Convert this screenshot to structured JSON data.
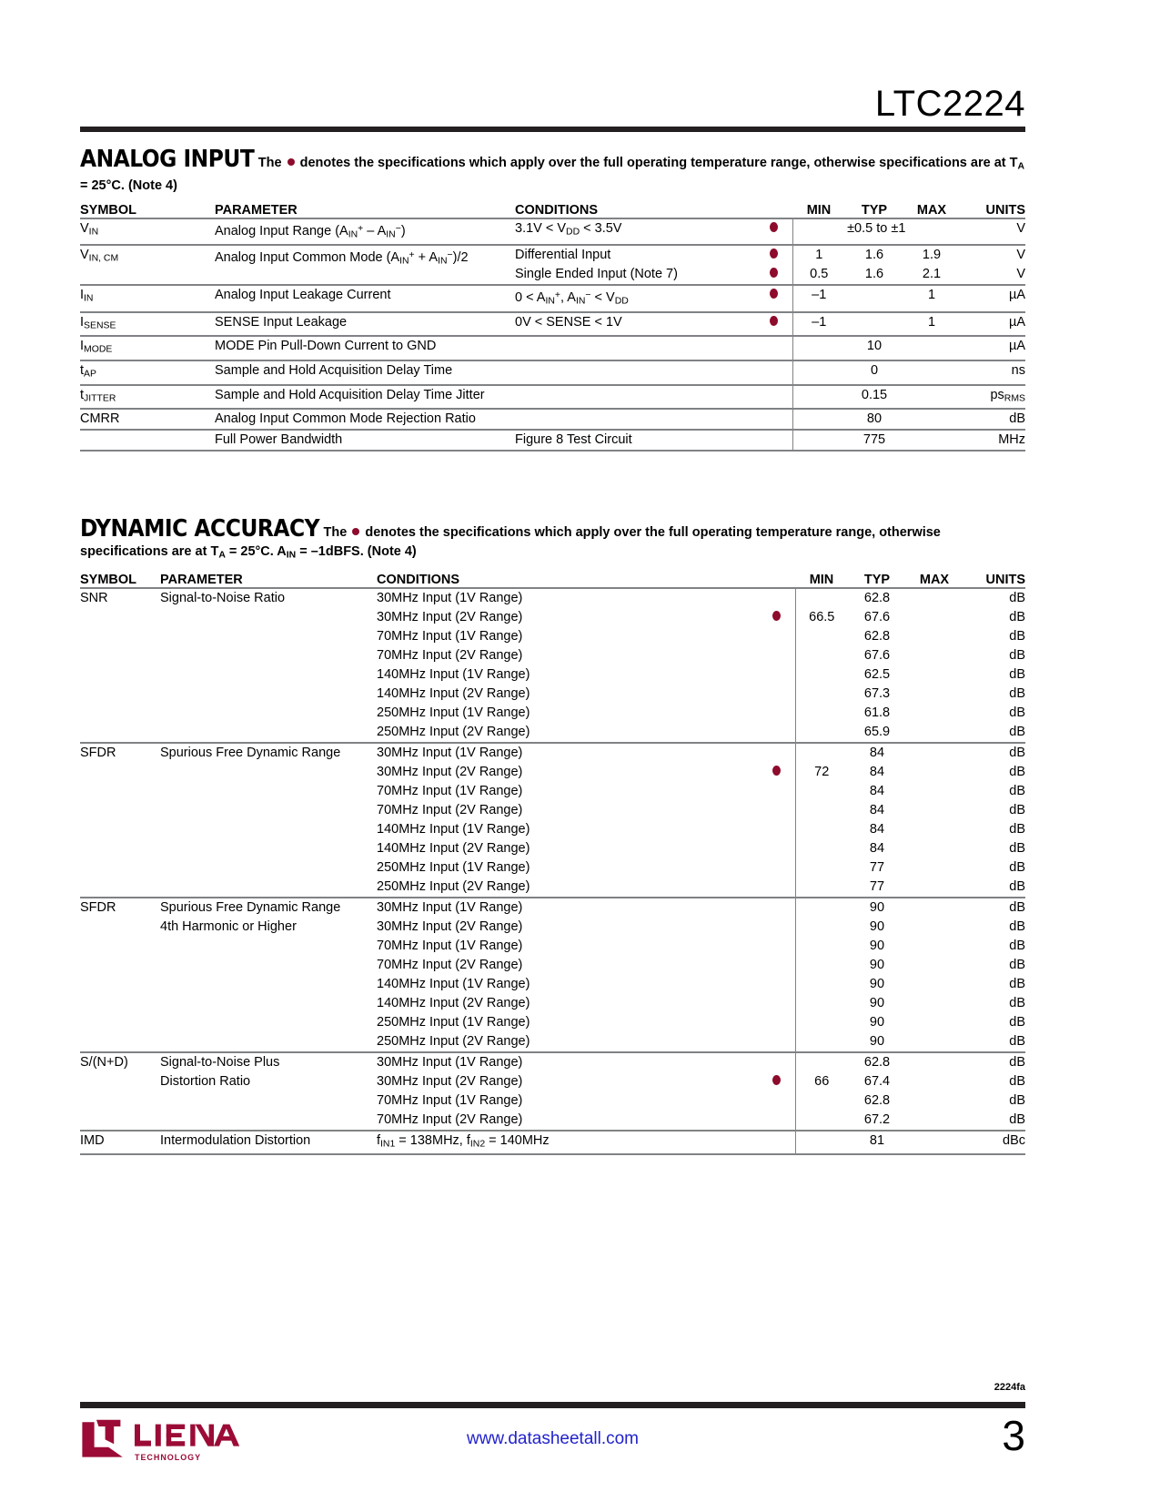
{
  "header": {
    "part_number": "LTC2224"
  },
  "sections": [
    {
      "title": "ANALOG INPUT",
      "note_pre": "The",
      "note_post": "denotes the specifications which apply over the full operating temperature range, otherwise specifications are at T",
      "note_sub": "A",
      "note_tail": " = 25°C. (Note 4)",
      "columns": [
        "SYMBOL",
        "PARAMETER",
        "CONDITIONS",
        "MIN",
        "TYP",
        "MAX",
        "UNITS"
      ],
      "rows": [
        {
          "symbol": "V",
          "symbol_sub": "IN",
          "parameter": "Analog Input Range (A",
          "parameter_parts": [
            "Analog Input Range (A",
            "IN",
            "+",
            " – A",
            "IN",
            "−",
            ")"
          ],
          "lines": [
            {
              "cond": "3.1V < VDD < 3.5V",
              "cond_parts": [
                "3.1V < V",
                "DD",
                " < 3.5V"
              ],
              "dot": true,
              "min": "",
              "typ": "±0.5 to ±1",
              "typ_span": true,
              "max": "",
              "units": "V"
            }
          ]
        },
        {
          "symbol": "V",
          "symbol_sub": "IN, CM",
          "parameter_parts": [
            "Analog Input Common Mode (A",
            "IN",
            "+",
            " + A",
            "IN",
            "−",
            ")/2"
          ],
          "lines": [
            {
              "cond": "Differential Input",
              "dot": true,
              "min": "1",
              "typ": "1.6",
              "max": "1.9",
              "units": "V"
            },
            {
              "cond": "Single Ended Input (Note 7)",
              "dot": true,
              "min": "0.5",
              "typ": "1.6",
              "max": "2.1",
              "units": "V"
            }
          ]
        },
        {
          "symbol": "I",
          "symbol_sub": "IN",
          "parameter_plain": "Analog Input Leakage Current",
          "lines": [
            {
              "cond_parts": [
                "0 < A",
                "IN",
                "+",
                ", A",
                "IN",
                "−",
                " < V",
                "DD",
                ""
              ],
              "dot": true,
              "min": "–1",
              "typ": "",
              "max": "1",
              "units": "µA"
            }
          ]
        },
        {
          "symbol": "I",
          "symbol_sub": "SENSE",
          "parameter_plain": "SENSE Input Leakage",
          "lines": [
            {
              "cond": "0V < SENSE < 1V",
              "dot": true,
              "min": "–1",
              "typ": "",
              "max": "1",
              "units": "µA"
            }
          ]
        },
        {
          "symbol": "I",
          "symbol_sub": "MODE",
          "parameter_plain": "MODE Pin Pull-Down Current to GND",
          "lines": [
            {
              "cond": "",
              "dot": false,
              "min": "",
              "typ": "10",
              "max": "",
              "units": "µA"
            }
          ]
        },
        {
          "symbol": "t",
          "symbol_sub": "AP",
          "parameter_plain": "Sample and Hold Acquisition Delay Time",
          "lines": [
            {
              "cond": "",
              "dot": false,
              "min": "",
              "typ": "0",
              "max": "",
              "units": "ns"
            }
          ]
        },
        {
          "symbol": "t",
          "symbol_sub": "JITTER",
          "parameter_plain": "Sample and Hold Acquisition Delay Time Jitter",
          "lines": [
            {
              "cond": "",
              "dot": false,
              "min": "",
              "typ": "0.15",
              "max": "",
              "units": "ps",
              "units_sub": "RMS"
            }
          ]
        },
        {
          "symbol": "CMRR",
          "symbol_sub": "",
          "parameter_plain": "Analog Input Common Mode Rejection Ratio",
          "lines": [
            {
              "cond": "",
              "dot": false,
              "min": "",
              "typ": "80",
              "max": "",
              "units": "dB"
            }
          ]
        },
        {
          "symbol": "",
          "symbol_sub": "",
          "parameter_plain": "Full Power Bandwidth",
          "lines": [
            {
              "cond": "Figure 8 Test Circuit",
              "dot": false,
              "min": "",
              "typ": "775",
              "max": "",
              "units": "MHz"
            }
          ]
        }
      ]
    },
    {
      "title": "DYNAMIC ACCURACY",
      "note_pre": "The",
      "note_post": "denotes the specifications which apply over the full operating temperature range, otherwise specifications are at T",
      "note_sub": "A",
      "note_tail": " = 25°C. A",
      "note_sub2": "IN",
      "note_tail2": " = –1dBFS. (Note 4)",
      "columns": [
        "SYMBOL",
        "PARAMETER",
        "CONDITIONS",
        "MIN",
        "TYP",
        "MAX",
        "UNITS"
      ],
      "rows": [
        {
          "symbol": "SNR",
          "parameter_plain": "Signal-to-Noise Ratio",
          "groups": [
            {
              "lines": [
                {
                  "cond": "30MHz Input (1V Range)",
                  "dot": false,
                  "min": "",
                  "typ": "62.8",
                  "max": "",
                  "units": "dB"
                },
                {
                  "cond": "30MHz Input (2V Range)",
                  "dot": true,
                  "min": "66.5",
                  "typ": "67.6",
                  "max": "",
                  "units": "dB"
                }
              ]
            },
            {
              "lines": [
                {
                  "cond": "70MHz Input (1V Range)",
                  "dot": false,
                  "min": "",
                  "typ": "62.8",
                  "max": "",
                  "units": "dB"
                },
                {
                  "cond": "70MHz Input (2V Range)",
                  "dot": false,
                  "min": "",
                  "typ": "67.6",
                  "max": "",
                  "units": "dB"
                }
              ]
            },
            {
              "lines": [
                {
                  "cond": "140MHz Input (1V Range)",
                  "dot": false,
                  "min": "",
                  "typ": "62.5",
                  "max": "",
                  "units": "dB"
                },
                {
                  "cond": "140MHz Input (2V Range)",
                  "dot": false,
                  "min": "",
                  "typ": "67.3",
                  "max": "",
                  "units": "dB"
                }
              ]
            },
            {
              "lines": [
                {
                  "cond": "250MHz Input (1V Range)",
                  "dot": false,
                  "min": "",
                  "typ": "61.8",
                  "max": "",
                  "units": "dB"
                },
                {
                  "cond": "250MHz Input (2V Range)",
                  "dot": false,
                  "min": "",
                  "typ": "65.9",
                  "max": "",
                  "units": "dB"
                }
              ]
            }
          ]
        },
        {
          "symbol": "SFDR",
          "parameter_plain": "Spurious Free Dynamic Range",
          "groups": [
            {
              "lines": [
                {
                  "cond": "30MHz Input (1V Range)",
                  "dot": false,
                  "min": "",
                  "typ": "84",
                  "max": "",
                  "units": "dB"
                },
                {
                  "cond": "30MHz Input (2V Range)",
                  "dot": true,
                  "min": "72",
                  "typ": "84",
                  "max": "",
                  "units": "dB"
                }
              ]
            },
            {
              "lines": [
                {
                  "cond": "70MHz Input (1V Range)",
                  "dot": false,
                  "min": "",
                  "typ": "84",
                  "max": "",
                  "units": "dB"
                },
                {
                  "cond": "70MHz Input (2V Range)",
                  "dot": false,
                  "min": "",
                  "typ": "84",
                  "max": "",
                  "units": "dB"
                }
              ]
            },
            {
              "lines": [
                {
                  "cond": "140MHz Input (1V Range)",
                  "dot": false,
                  "min": "",
                  "typ": "84",
                  "max": "",
                  "units": "dB"
                },
                {
                  "cond": "140MHz Input (2V Range)",
                  "dot": false,
                  "min": "",
                  "typ": "84",
                  "max": "",
                  "units": "dB"
                }
              ]
            },
            {
              "lines": [
                {
                  "cond": "250MHz Input (1V Range)",
                  "dot": false,
                  "min": "",
                  "typ": "77",
                  "max": "",
                  "units": "dB"
                },
                {
                  "cond": "250MHz Input (2V Range)",
                  "dot": false,
                  "min": "",
                  "typ": "77",
                  "max": "",
                  "units": "dB"
                }
              ]
            }
          ]
        },
        {
          "symbol": "SFDR",
          "parameter_line1": "Spurious Free Dynamic Range",
          "parameter_line2": "4th Harmonic or Higher",
          "groups": [
            {
              "lines": [
                {
                  "cond": "30MHz Input (1V Range)",
                  "dot": false,
                  "min": "",
                  "typ": "90",
                  "max": "",
                  "units": "dB"
                },
                {
                  "cond": "30MHz Input (2V Range)",
                  "dot": false,
                  "min": "",
                  "typ": "90",
                  "max": "",
                  "units": "dB"
                }
              ]
            },
            {
              "lines": [
                {
                  "cond": "70MHz Input (1V Range)",
                  "dot": false,
                  "min": "",
                  "typ": "90",
                  "max": "",
                  "units": "dB"
                },
                {
                  "cond": "70MHz Input (2V Range)",
                  "dot": false,
                  "min": "",
                  "typ": "90",
                  "max": "",
                  "units": "dB"
                }
              ]
            },
            {
              "lines": [
                {
                  "cond": "140MHz Input (1V Range)",
                  "dot": false,
                  "min": "",
                  "typ": "90",
                  "max": "",
                  "units": "dB"
                },
                {
                  "cond": "140MHz Input (2V Range)",
                  "dot": false,
                  "min": "",
                  "typ": "90",
                  "max": "",
                  "units": "dB"
                }
              ]
            },
            {
              "lines": [
                {
                  "cond": "250MHz Input (1V Range)",
                  "dot": false,
                  "min": "",
                  "typ": "90",
                  "max": "",
                  "units": "dB"
                },
                {
                  "cond": "250MHz Input (2V Range)",
                  "dot": false,
                  "min": "",
                  "typ": "90",
                  "max": "",
                  "units": "dB"
                }
              ]
            }
          ]
        },
        {
          "symbol": "S/(N+D)",
          "parameter_line1": "Signal-to-Noise Plus",
          "parameter_line2": "Distortion Ratio",
          "groups": [
            {
              "lines": [
                {
                  "cond": "30MHz Input (1V Range)",
                  "dot": false,
                  "min": "",
                  "typ": "62.8",
                  "max": "",
                  "units": "dB"
                },
                {
                  "cond": "30MHz Input (2V Range)",
                  "dot": true,
                  "min": "66",
                  "typ": "67.4",
                  "max": "",
                  "units": "dB"
                }
              ]
            },
            {
              "lines": [
                {
                  "cond": "70MHz Input (1V Range)",
                  "dot": false,
                  "min": "",
                  "typ": "62.8",
                  "max": "",
                  "units": "dB"
                },
                {
                  "cond": "70MHz Input (2V Range)",
                  "dot": false,
                  "min": "",
                  "typ": "67.2",
                  "max": "",
                  "units": "dB"
                }
              ]
            }
          ]
        },
        {
          "symbol": "IMD",
          "parameter_plain": "Intermodulation Distortion",
          "groups": [
            {
              "lines": [
                {
                  "cond_parts": [
                    "f",
                    "IN1",
                    " = 138MHz, f",
                    "IN2",
                    " = 140MHz"
                  ],
                  "dot": false,
                  "min": "",
                  "typ": "81",
                  "max": "",
                  "units": "dBc"
                }
              ]
            }
          ]
        }
      ]
    }
  ],
  "footer": {
    "doc_code": "2224fa",
    "url": "www.datasheetall.com",
    "page_number": "3",
    "logo_name": "LINEAR",
    "logo_sub": "TECHNOLOGY"
  },
  "colors": {
    "bullet": "#8d0b2b",
    "rule": "#231f20",
    "link": "#2222cc",
    "gridline": "#808285"
  }
}
